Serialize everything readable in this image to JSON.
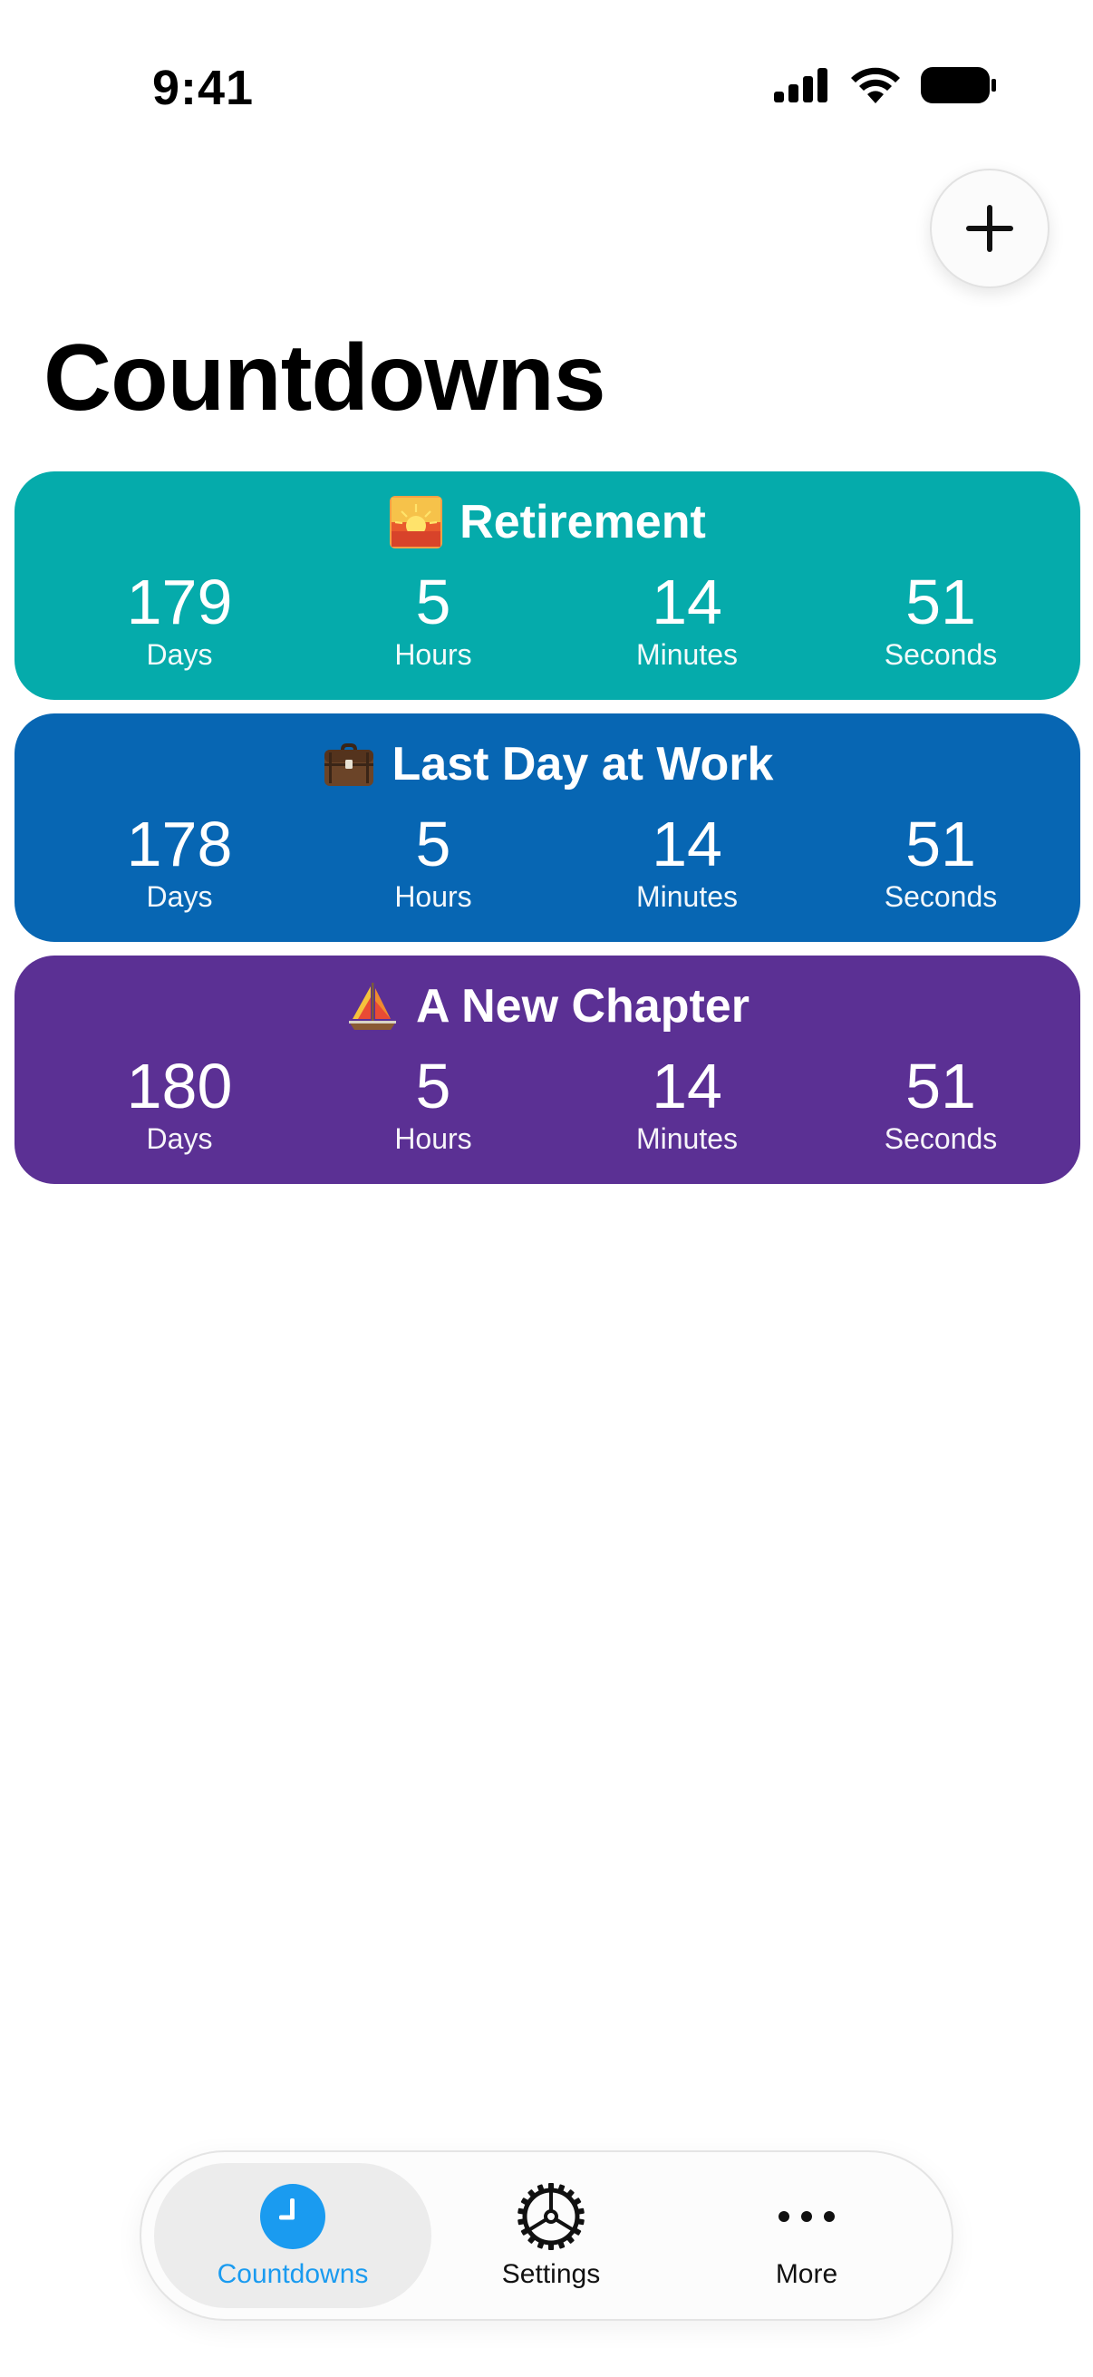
{
  "status_bar": {
    "time": "9:41"
  },
  "header": {
    "add_icon": "plus-icon",
    "title": "Countdowns"
  },
  "countdowns": [
    {
      "emoji": "sunrise",
      "title": "Retirement",
      "color": "#05ABAB",
      "units": [
        {
          "value": "179",
          "label": "Days"
        },
        {
          "value": "5",
          "label": "Hours"
        },
        {
          "value": "14",
          "label": "Minutes"
        },
        {
          "value": "51",
          "label": "Seconds"
        }
      ]
    },
    {
      "emoji": "briefcase",
      "title": "Last Day at Work",
      "color": "#0766B3",
      "units": [
        {
          "value": "178",
          "label": "Days"
        },
        {
          "value": "5",
          "label": "Hours"
        },
        {
          "value": "14",
          "label": "Minutes"
        },
        {
          "value": "51",
          "label": "Seconds"
        }
      ]
    },
    {
      "emoji": "sailboat",
      "title": "A New Chapter",
      "color": "#5B3094",
      "units": [
        {
          "value": "180",
          "label": "Days"
        },
        {
          "value": "5",
          "label": "Hours"
        },
        {
          "value": "14",
          "label": "Minutes"
        },
        {
          "value": "51",
          "label": "Seconds"
        }
      ]
    }
  ],
  "tab_bar": {
    "tabs": [
      {
        "label": "Countdowns",
        "icon": "clock-icon",
        "selected": true
      },
      {
        "label": "Settings",
        "icon": "gear-icon",
        "selected": false
      },
      {
        "label": "More",
        "icon": "ellipsis-icon",
        "selected": false
      }
    ],
    "accent": "#1A9BF0"
  }
}
